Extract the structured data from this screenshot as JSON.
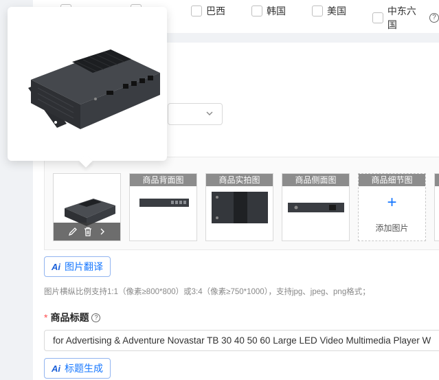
{
  "countries": [
    {
      "label": "巴西"
    },
    {
      "label": "韩国"
    },
    {
      "label": "美国"
    },
    {
      "label": "中东六国"
    }
  ],
  "gallery": {
    "items": [
      {
        "caption": "商品背面图"
      },
      {
        "caption": "商品实拍图"
      },
      {
        "caption": "商品侧面图"
      },
      {
        "caption": "商品细节图",
        "add_label": "添加图片"
      }
    ]
  },
  "image_translate": {
    "label": "图片翻译",
    "ai_mark": "Ai"
  },
  "hint": "图片横纵比例支持1:1（像素≥800*800）或3:4（像素≥750*1000），支持jpg、jpeg、png格式；",
  "product_title": {
    "required_mark": "*",
    "label": "商品标题",
    "value": "for Advertising & Adventure Novastar TB 30 40 50 60 Large LED Video Multimedia Player  W"
  },
  "title_generate": {
    "label": "标题生成",
    "ai_mark": "Ai"
  },
  "colors": {
    "accent": "#1677ff",
    "caption_bg": "#8c8c8c",
    "device": "#3a3d42"
  }
}
